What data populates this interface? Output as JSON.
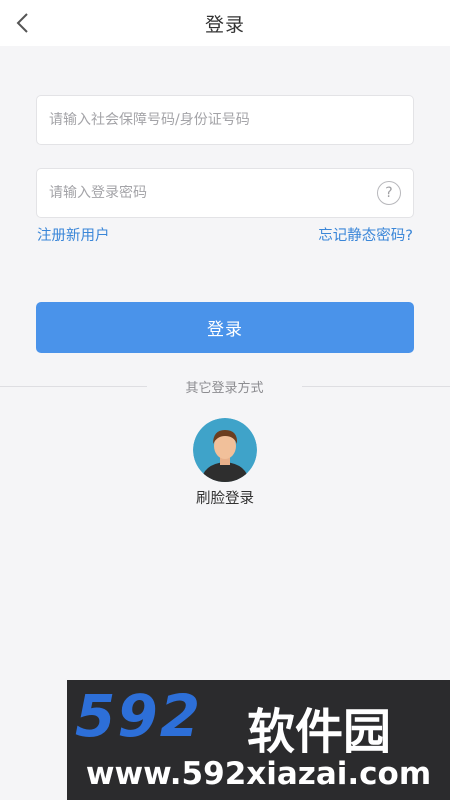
{
  "header": {
    "title": "登录",
    "back_icon": "chevron-left-icon"
  },
  "form": {
    "username_placeholder": "请输入社会保障号码/身份证号码",
    "username_value": "",
    "password_placeholder": "请输入登录密码",
    "password_value": "",
    "help_icon": "question-circle-icon",
    "help_symbol": "?"
  },
  "links": {
    "register": "注册新用户",
    "forgot": "忘记静态密码?"
  },
  "login_button": "登录",
  "other_login": {
    "divider_text": "其它登录方式",
    "face_label": "刷脸登录",
    "face_icon": "face-avatar-icon"
  },
  "watermark": {
    "number": "592",
    "name": "软件园",
    "url": "www.592xiazai.com"
  },
  "colors": {
    "accent": "#4a93ea",
    "link": "#3a86d8",
    "background": "#f5f5f7"
  }
}
